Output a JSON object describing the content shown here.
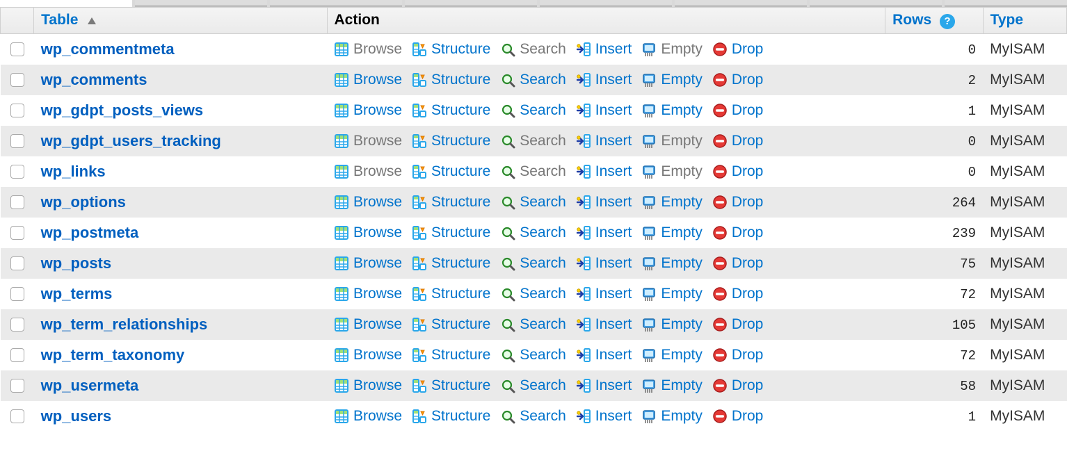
{
  "headers": {
    "table": "Table",
    "action": "Action",
    "rows": "Rows",
    "type": "Type"
  },
  "actionLabels": {
    "browse": "Browse",
    "structure": "Structure",
    "search": "Search",
    "insert": "Insert",
    "empty": "Empty",
    "drop": "Drop"
  },
  "tables": [
    {
      "name": "wp_commentmeta",
      "rows": 0,
      "type": "MyISAM",
      "hasData": false
    },
    {
      "name": "wp_comments",
      "rows": 2,
      "type": "MyISAM",
      "hasData": true
    },
    {
      "name": "wp_gdpt_posts_views",
      "rows": 1,
      "type": "MyISAM",
      "hasData": true
    },
    {
      "name": "wp_gdpt_users_tracking",
      "rows": 0,
      "type": "MyISAM",
      "hasData": false
    },
    {
      "name": "wp_links",
      "rows": 0,
      "type": "MyISAM",
      "hasData": false
    },
    {
      "name": "wp_options",
      "rows": 264,
      "type": "MyISAM",
      "hasData": true
    },
    {
      "name": "wp_postmeta",
      "rows": 239,
      "type": "MyISAM",
      "hasData": true
    },
    {
      "name": "wp_posts",
      "rows": 75,
      "type": "MyISAM",
      "hasData": true
    },
    {
      "name": "wp_terms",
      "rows": 72,
      "type": "MyISAM",
      "hasData": true
    },
    {
      "name": "wp_term_relationships",
      "rows": 105,
      "type": "MyISAM",
      "hasData": true
    },
    {
      "name": "wp_term_taxonomy",
      "rows": 72,
      "type": "MyISAM",
      "hasData": true
    },
    {
      "name": "wp_usermeta",
      "rows": 58,
      "type": "MyISAM",
      "hasData": true
    },
    {
      "name": "wp_users",
      "rows": 1,
      "type": "MyISAM",
      "hasData": true
    }
  ]
}
